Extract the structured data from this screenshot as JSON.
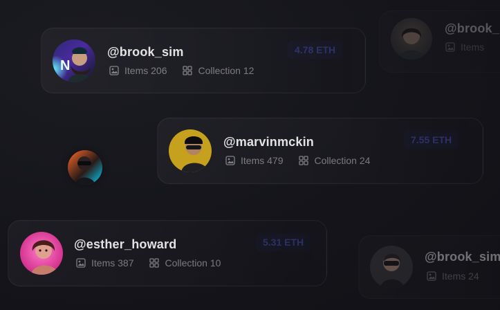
{
  "cards": [
    {
      "username": "@brook_sim",
      "items_label": "Items 206",
      "collection_label": "Collection 12",
      "price": "4.78 ETH"
    },
    {
      "username": "@marvinmckin",
      "items_label": "Items 479",
      "collection_label": "Collection 24",
      "price": "7.55 ETH"
    },
    {
      "username": "@esther_howard",
      "items_label": "Items 387",
      "collection_label": "Collection 10",
      "price": "5.31 ETH"
    },
    {
      "username": "@brook_sim",
      "items_label": "Items 24",
      "collection_label": "",
      "price": ""
    },
    {
      "username": "@brook_sim",
      "items_label": "Items",
      "collection_label": "",
      "price": ""
    }
  ],
  "colors": {
    "background": "#14141a",
    "price_accent": "#5a63ff"
  }
}
